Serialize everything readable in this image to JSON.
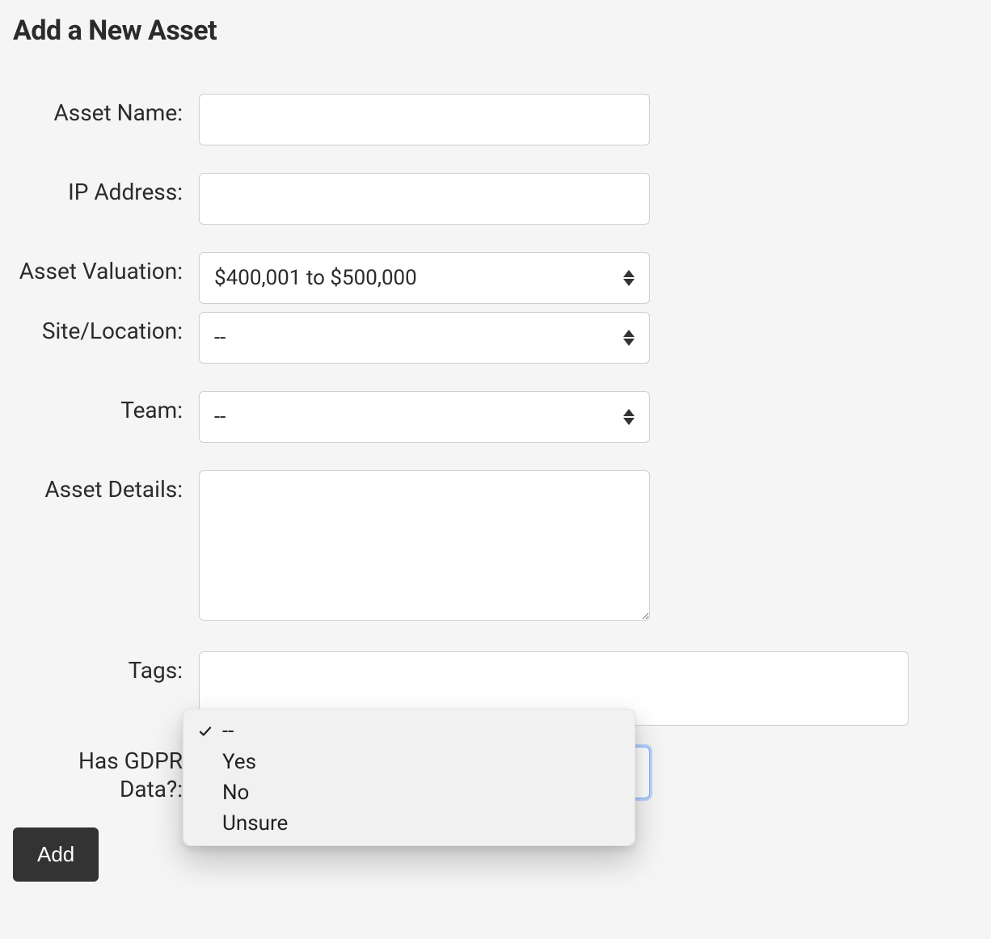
{
  "title": "Add a New Asset",
  "labels": {
    "asset_name": "Asset Name:",
    "ip_address": "IP Address:",
    "asset_valuation": "Asset Valuation:",
    "site_location": "Site/Location:",
    "team": "Team:",
    "asset_details": "Asset Details:",
    "tags": "Tags:",
    "has_gdpr_data": "Has GDPR Data?:"
  },
  "values": {
    "asset_name": "",
    "ip_address": "",
    "asset_valuation": "$400,001 to $500,000",
    "site_location": "--",
    "team": "--",
    "asset_details": "",
    "tags": "",
    "has_gdpr_data": "--"
  },
  "gdpr_dropdown": {
    "open": true,
    "selected_index": 0,
    "options": [
      "--",
      "Yes",
      "No",
      "Unsure"
    ]
  },
  "buttons": {
    "add": "Add"
  }
}
